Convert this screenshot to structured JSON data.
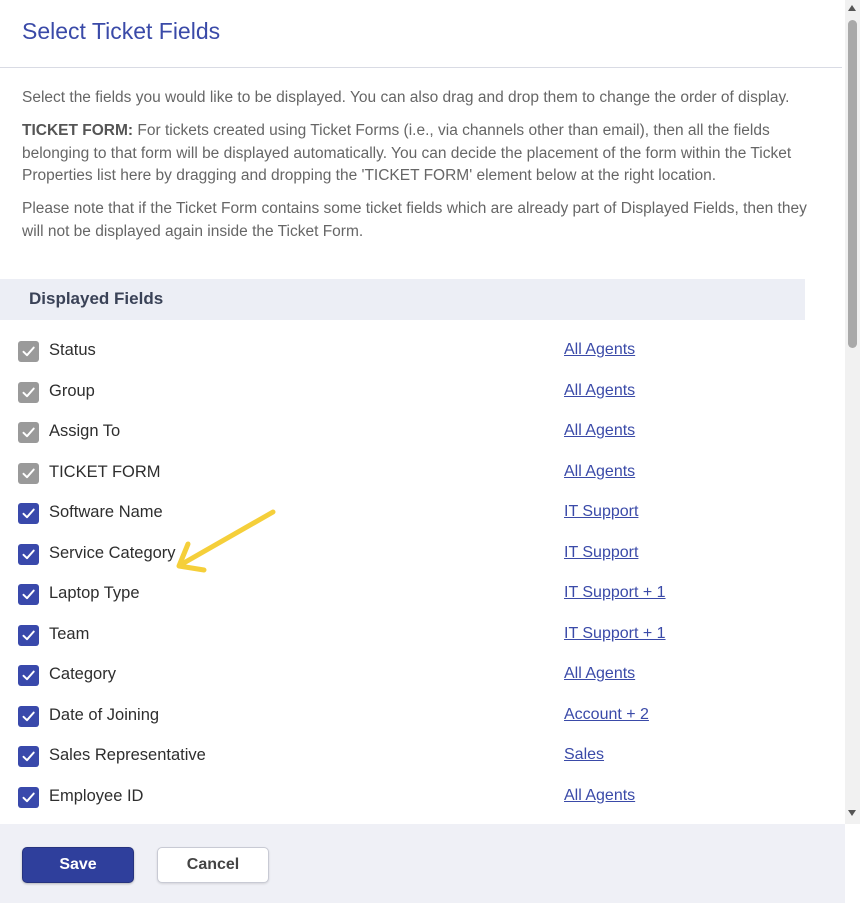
{
  "dialog": {
    "title": "Select Ticket Fields"
  },
  "description": {
    "intro": "Select the fields you would like to be displayed. You can also drag and drop them to change the order of display.",
    "ticket_form_label": "TICKET FORM:",
    "ticket_form_text": "For tickets created using Ticket Forms (i.e., via channels other than email), then all the fields belonging to that form will be displayed automatically. You can decide the placement of the form within the Ticket Properties list here by dragging and dropping the 'TICKET FORM' element below at the right location.",
    "note": "Please note that if the Ticket Form contains some ticket fields which are already part of Displayed Fields, then they will not be displayed again inside the Ticket Form."
  },
  "section": {
    "title": "Displayed Fields"
  },
  "fields": [
    {
      "name": "Status",
      "visibility": "All Agents",
      "checked": true,
      "disabled": true
    },
    {
      "name": "Group",
      "visibility": "All Agents",
      "checked": true,
      "disabled": true
    },
    {
      "name": "Assign To",
      "visibility": "All Agents",
      "checked": true,
      "disabled": true
    },
    {
      "name": "TICKET FORM",
      "visibility": "All Agents",
      "checked": true,
      "disabled": true
    },
    {
      "name": "Software Name",
      "visibility": "IT Support",
      "checked": true,
      "disabled": false
    },
    {
      "name": "Service Category",
      "visibility": "IT Support",
      "checked": true,
      "disabled": false
    },
    {
      "name": "Laptop Type",
      "visibility": "IT Support + 1",
      "checked": true,
      "disabled": false
    },
    {
      "name": "Team",
      "visibility": "IT Support + 1",
      "checked": true,
      "disabled": false
    },
    {
      "name": "Category",
      "visibility": "All Agents",
      "checked": true,
      "disabled": false
    },
    {
      "name": "Date of Joining",
      "visibility": "Account + 2",
      "checked": true,
      "disabled": false
    },
    {
      "name": "Sales Representative",
      "visibility": "Sales",
      "checked": true,
      "disabled": false
    },
    {
      "name": "Employee ID",
      "visibility": "All Agents",
      "checked": true,
      "disabled": false
    }
  ],
  "footer": {
    "save_label": "Save",
    "cancel_label": "Cancel"
  },
  "colors": {
    "accent": "#3a4aa8",
    "checkbox_enabled": "#3949ab",
    "checkbox_disabled": "#9a9a9a",
    "annotation_arrow": "#f5cf3a"
  },
  "icons": {
    "checkbox": "check-icon",
    "annotation": "arrow-annotation-icon"
  }
}
